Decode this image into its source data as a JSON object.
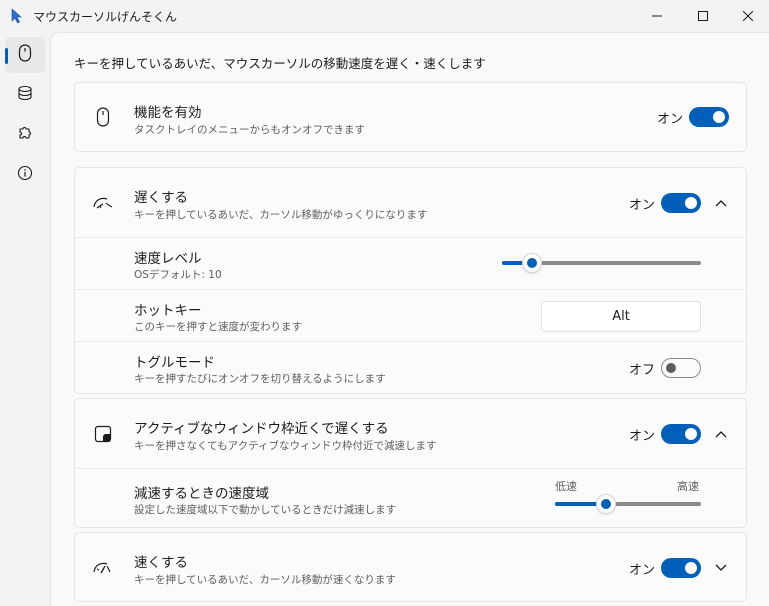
{
  "window": {
    "title": "マウスカーソルげんそくん"
  },
  "page": {
    "description": "キーを押しているあいだ、マウスカーソルの移動速度を遅く・速くします"
  },
  "sections": {
    "enable": {
      "title": "機能を有効",
      "subtitle": "タスクトレイのメニューからもオンオフできます",
      "state_label": "オン",
      "enabled": true
    },
    "slow": {
      "title": "遅くする",
      "subtitle": "キーを押しているあいだ、カーソル移動がゆっくりになります",
      "state_label": "オン",
      "enabled": true,
      "expanded": true,
      "speed_level": {
        "title": "速度レベル",
        "subtitle": "OSデフォルト: 10",
        "value_fraction": 0.15
      },
      "hotkey": {
        "title": "ホットキー",
        "subtitle": "このキーを押すと速度が変わります",
        "value": "Alt"
      },
      "toggle_mode": {
        "title": "トグルモード",
        "subtitle": "キーを押すたびにオンオフを切り替えるようにします",
        "state_label": "オフ",
        "enabled": false
      }
    },
    "active_window": {
      "title": "アクティブなウィンドウ枠近くで遅くする",
      "subtitle": "キーを押さなくてもアクティブなウィンドウ枠付近で減速します",
      "state_label": "オン",
      "enabled": true,
      "expanded": true,
      "range": {
        "title": "減速するときの速度域",
        "subtitle": "設定した速度域以下で動かしているときだけ減速します",
        "low_label": "低速",
        "high_label": "高速",
        "value_fraction": 0.35
      }
    },
    "fast": {
      "title": "速くする",
      "subtitle": "キーを押しているあいだ、カーソル移動が速くなります",
      "state_label": "オン",
      "enabled": true,
      "expanded": false
    }
  },
  "colors": {
    "accent": "#005fb8",
    "background": "#f3f3f3",
    "card": "#fbfbfb"
  }
}
